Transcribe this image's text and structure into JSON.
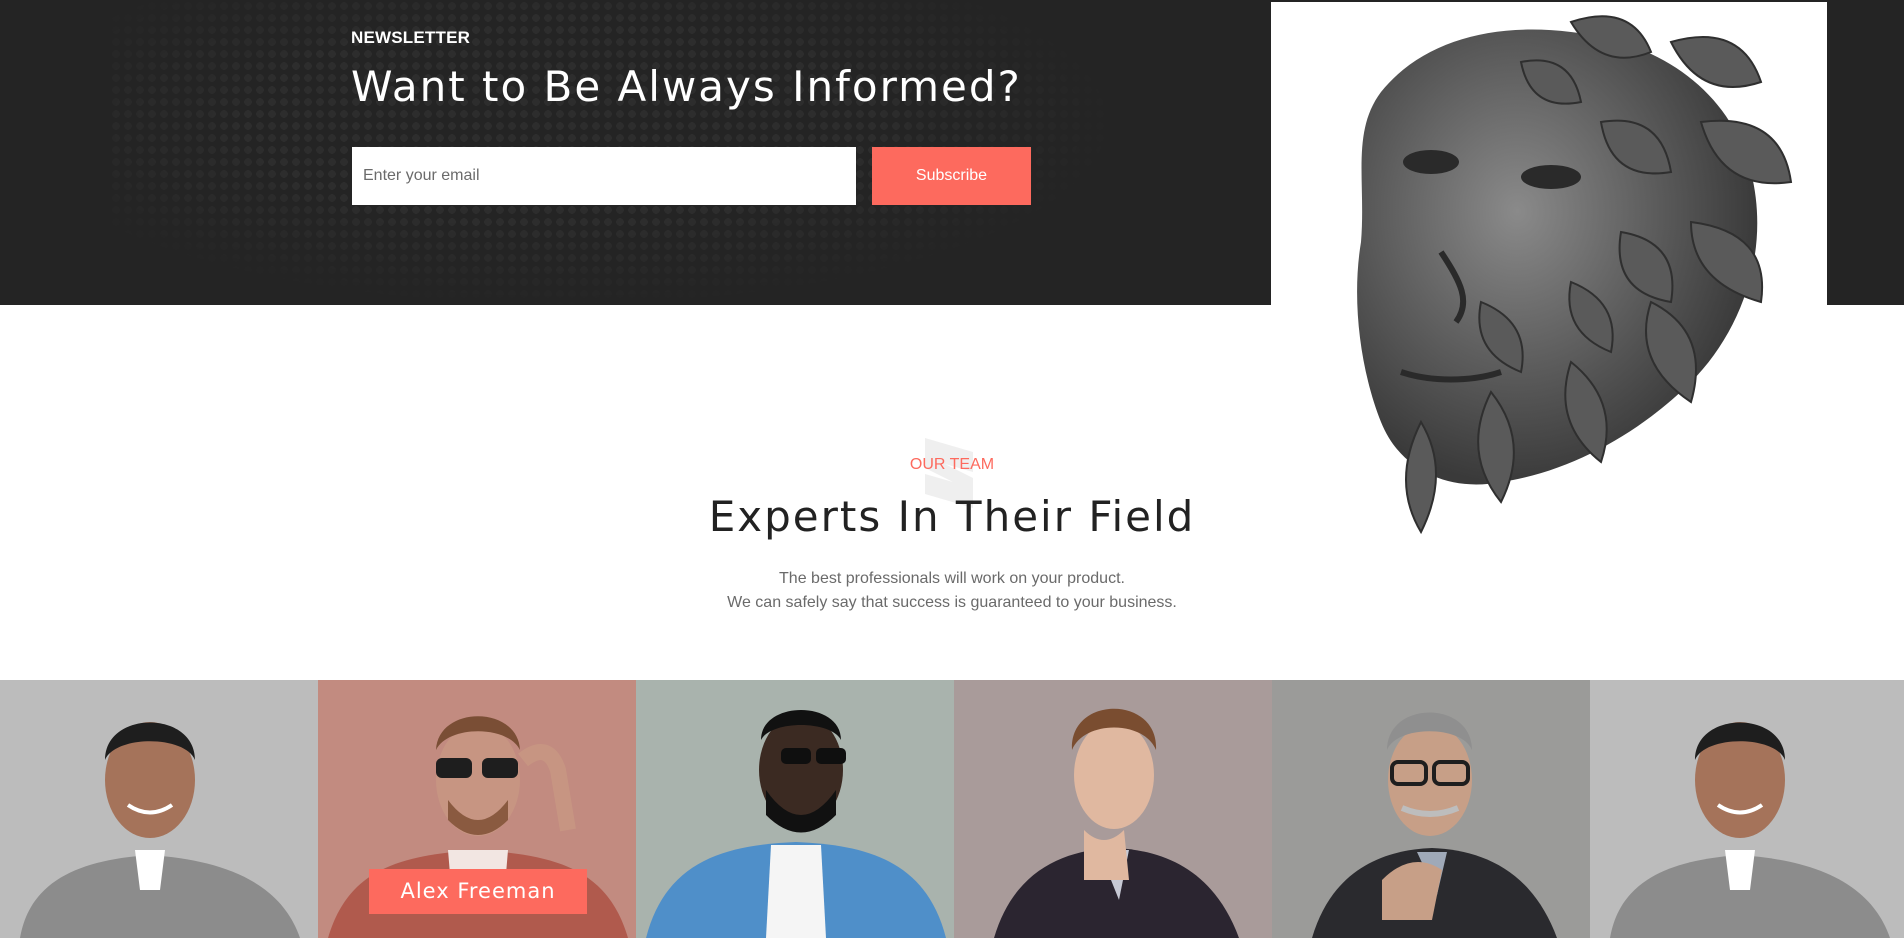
{
  "newsletter": {
    "label": "NEWSLETTER",
    "title": "Want to Be Always Informed?",
    "email_placeholder": "Enter your email",
    "email_value": "",
    "subscribe_label": "Subscribe"
  },
  "team": {
    "label": "OUR TEAM",
    "title": "Experts In Their Field",
    "description_line1": "The best professionals will work on your product.",
    "description_line2": "We can safely say that success is guaranteed to your business."
  },
  "members": [
    {
      "name": "",
      "bg": "#bcbcbc"
    },
    {
      "name": "Alex Freeman",
      "bg": "#c28b80"
    },
    {
      "name": "",
      "bg": "#a9b3ad"
    },
    {
      "name": "",
      "bg": "#a99b9a"
    },
    {
      "name": "",
      "bg": "#9b9b99"
    },
    {
      "name": "",
      "bg": "#bcbcbc"
    }
  ],
  "colors": {
    "accent": "#fd6a5e",
    "dark": "#242424",
    "text_muted": "#6a6a6a"
  }
}
